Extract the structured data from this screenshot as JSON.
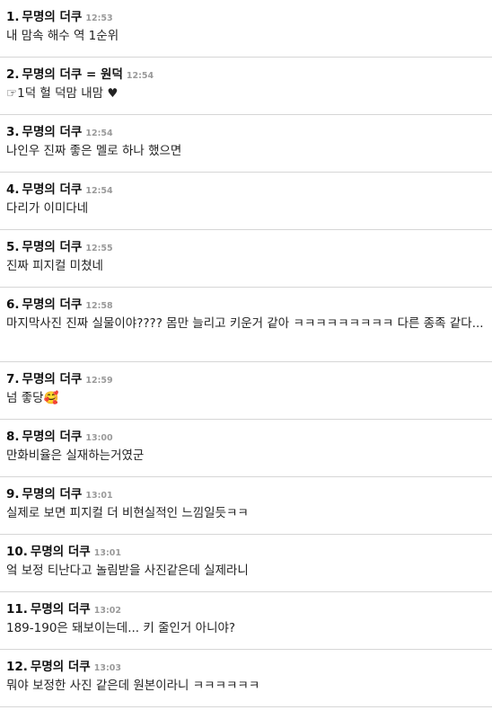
{
  "comments": [
    {
      "num": "1.",
      "nick": "무명의 더쿠",
      "time": "12:53",
      "text": "내 맘속 해수 역 1순위"
    },
    {
      "num": "2.",
      "nick": "무명의 더쿠 = 원덕",
      "time": "12:54",
      "text": "☞1덕 헐 덕맘 내맘 ♥"
    },
    {
      "num": "3.",
      "nick": "무명의 더쿠",
      "time": "12:54",
      "text": "나인우 진짜 좋은 멜로 하나 했으면"
    },
    {
      "num": "4.",
      "nick": "무명의 더쿠",
      "time": "12:54",
      "text": "다리가 이미다네"
    },
    {
      "num": "5.",
      "nick": "무명의 더쿠",
      "time": "12:55",
      "text": "진짜 피지컬 미쳤네"
    },
    {
      "num": "6.",
      "nick": "무명의 더쿠",
      "time": "12:58",
      "text": "마지막사진 진짜 실물이야???? 몸만 늘리고 키운거 같아 ㅋㅋㅋㅋㅋㅋㅋㅋㅋ 다른 종족 같다..."
    },
    {
      "num": "7.",
      "nick": "무명의 더쿠",
      "time": "12:59",
      "text": "넘 좋당🥰"
    },
    {
      "num": "8.",
      "nick": "무명의 더쿠",
      "time": "13:00",
      "text": "만화비율은 실재하는거였군"
    },
    {
      "num": "9.",
      "nick": "무명의 더쿠",
      "time": "13:01",
      "text": "실제로 보면 피지컬 더 비현실적인 느낌일듯ㅋㅋ"
    },
    {
      "num": "10.",
      "nick": "무명의 더쿠",
      "time": "13:01",
      "text": "엌 보정 티난다고 놀림받을 사진같은데 실제라니"
    },
    {
      "num": "11.",
      "nick": "무명의 더쿠",
      "time": "13:02",
      "text": "189-190은 돼보이는데... 키 줄인거 아니야?"
    },
    {
      "num": "12.",
      "nick": "무명의 더쿠",
      "time": "13:03",
      "text": "뭐야 보정한 사진 같은데 원본이라니 ㅋㅋㅋㅋㅋㅋ"
    }
  ]
}
